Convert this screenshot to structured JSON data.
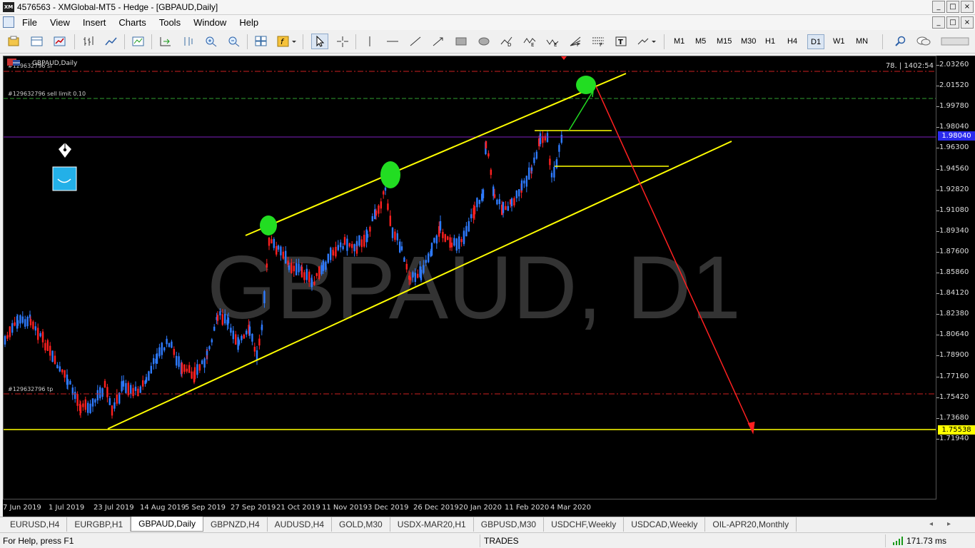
{
  "app": {
    "title": "4576563 - XMGlobal-MT5 - Hedge - [GBPAUD,Daily]",
    "icon_text": "XM",
    "window_buttons": [
      "_",
      "□",
      "×"
    ]
  },
  "menu": [
    "File",
    "View",
    "Insert",
    "Charts",
    "Tools",
    "Window",
    "Help"
  ],
  "toolbar": {
    "timeframes": [
      "M1",
      "M5",
      "M15",
      "M30",
      "H1",
      "H4",
      "D1",
      "W1",
      "MN"
    ],
    "active_timeframe": "D1"
  },
  "chart": {
    "symbol_label": "GBPAUD,Daily",
    "watermark": "GBPAUD, D1",
    "info_right": "78. | 1402:54",
    "order_labels": {
      "sl_label": "#129632796 sl",
      "sell_limit_label": "#129632796 sell limit 0.10",
      "tp_label": "#129632796 tp"
    },
    "price_axis": [
      "2.03260",
      "2.01520",
      "1.99780",
      "1.98040",
      "1.96300",
      "1.94560",
      "1.92820",
      "1.91080",
      "1.89340",
      "1.87600",
      "1.85860",
      "1.84120",
      "1.82380",
      "1.80640",
      "1.78900",
      "1.77160",
      "1.75420",
      "1.73680",
      "1.71940"
    ],
    "current_price_box": "1.98040",
    "hline_price_box": "1.75538",
    "time_axis": [
      "7 Jun 2019",
      "1 Jul 2019",
      "23 Jul 2019",
      "14 Aug 2019",
      "5 Sep 2019",
      "27 Sep 2019",
      "21 Oct 2019",
      "11 Nov 2019",
      "3 Dec 2019",
      "26 Dec 2019",
      "20 Jan 2020",
      "11 Feb 2020",
      "4 Mar 2020"
    ],
    "colors": {
      "background": "#000000",
      "bull": "#2e7bff",
      "bear": "#ff2020",
      "channel": "#ffff00",
      "marker": "#22dd22",
      "arrow_down": "#ff2020",
      "arrow_up": "#22dd22",
      "bid_line": "#8020c0"
    }
  },
  "tabs": [
    "EURUSD,H4",
    "EURGBP,H1",
    "GBPAUD,Daily",
    "GBPNZD,H4",
    "AUDUSD,H4",
    "GOLD,M30",
    "USDX-MAR20,H1",
    "GBPUSD,M30",
    "USDCHF,Weekly",
    "USDCAD,Weekly",
    "OIL-APR20,Monthly"
  ],
  "active_tab": "GBPAUD,Daily",
  "status": {
    "help": "For Help, press F1",
    "trades": "TRADES",
    "ping": "171.73 ms"
  }
}
